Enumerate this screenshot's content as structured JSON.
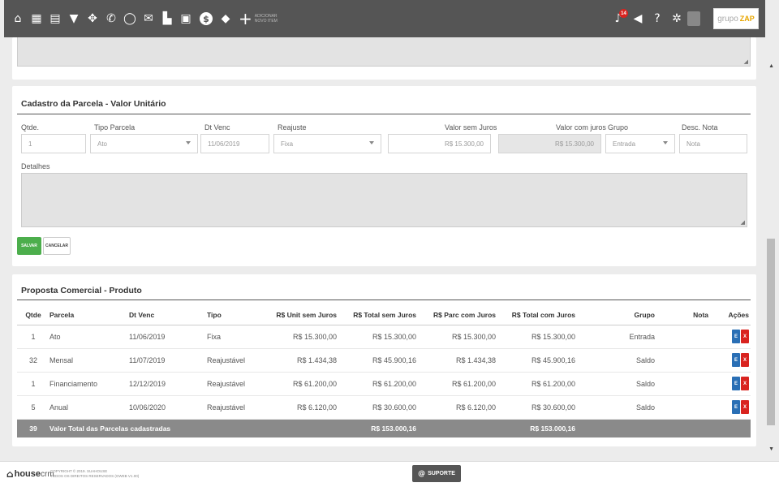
{
  "toolbar": {
    "icons": [
      {
        "name": "home-icon",
        "glyph": "⌂"
      },
      {
        "name": "calendar-icon",
        "glyph": "▦"
      },
      {
        "name": "calendar-list-icon",
        "glyph": "▤"
      },
      {
        "name": "filter-icon",
        "glyph": "▼"
      },
      {
        "name": "handshake-icon",
        "glyph": "✥"
      },
      {
        "name": "phone-icon",
        "glyph": "✆"
      },
      {
        "name": "chat-icon",
        "glyph": "◯"
      },
      {
        "name": "mail-icon",
        "glyph": "✉"
      },
      {
        "name": "building-icon",
        "glyph": "▙"
      },
      {
        "name": "calculator-icon",
        "glyph": "▣"
      },
      {
        "name": "dollar-icon",
        "glyph": "$"
      },
      {
        "name": "graduation-icon",
        "glyph": "◆"
      }
    ],
    "add_label": "ADICIONAR NOVO ITEM",
    "notification_count": "14",
    "brand_name": "grupo",
    "brand_accent": "ZAP"
  },
  "installment_form": {
    "title": "Cadastro da Parcela - Valor Unitário",
    "labels": {
      "qty": "Qtde.",
      "type": "Tipo Parcela",
      "due": "Dt Venc",
      "adjust": "Reajuste",
      "value_no_interest": "Valor sem Juros",
      "value_with_interest": "Valor com juros",
      "group": "Grupo",
      "note": "Desc. Nota",
      "details": "Detalhes"
    },
    "values": {
      "qty": "1",
      "type": "Ato",
      "due": "11/06/2019",
      "adjust": "Fixa",
      "value_no_interest": "R$ 15.300,00",
      "value_with_interest": "R$ 15.300,00",
      "group": "Entrada",
      "note": "Nota"
    },
    "save_label": "SALVAR",
    "cancel_label": "CANCELAR"
  },
  "proposal": {
    "title": "Proposta Comercial - Produto",
    "columns": [
      "Qtde",
      "Parcela",
      "Dt Venc",
      "Tipo",
      "R$ Unit sem Juros",
      "R$ Total sem Juros",
      "R$ Parc com Juros",
      "R$ Total com Juros",
      "Grupo",
      "Nota",
      "Ações"
    ],
    "rows": [
      {
        "qty": "1",
        "parcela": "Ato",
        "due": "11/06/2019",
        "tipo": "Fixa",
        "unit": "R$ 15.300,00",
        "total": "R$ 15.300,00",
        "parc_juros": "R$ 15.300,00",
        "total_juros": "R$ 15.300,00",
        "grupo": "Entrada",
        "nota": ""
      },
      {
        "qty": "32",
        "parcela": "Mensal",
        "due": "11/07/2019",
        "tipo": "Reajustável",
        "unit": "R$ 1.434,38",
        "total": "R$ 45.900,16",
        "parc_juros": "R$ 1.434,38",
        "total_juros": "R$ 45.900,16",
        "grupo": "Saldo",
        "nota": ""
      },
      {
        "qty": "1",
        "parcela": "Financiamento",
        "due": "12/12/2019",
        "tipo": "Reajustável",
        "unit": "R$ 61.200,00",
        "total": "R$ 61.200,00",
        "parc_juros": "R$ 61.200,00",
        "total_juros": "R$ 61.200,00",
        "grupo": "Saldo",
        "nota": ""
      },
      {
        "qty": "5",
        "parcela": "Anual",
        "due": "10/06/2020",
        "tipo": "Reajustável",
        "unit": "R$ 6.120,00",
        "total": "R$ 30.600,00",
        "parc_juros": "R$ 6.120,00",
        "total_juros": "R$ 30.600,00",
        "grupo": "Saldo",
        "nota": ""
      }
    ],
    "edit_label": "E",
    "delete_label": "X",
    "total_row": {
      "qty": "39",
      "label": "Valor Total das Parcelas cadastradas",
      "total": "R$ 153.000,16",
      "total_juros": "R$ 153.000,16"
    }
  },
  "footer": {
    "brand": "house",
    "brand_suffix": "crm",
    "copyright_1": "COPYRIGHT © 2019. SUAHOUSE",
    "copyright_2": "TODOS OS DIREITOS RESERVADOS (GWEB V1.00)",
    "support_label": "SUPORTE"
  }
}
